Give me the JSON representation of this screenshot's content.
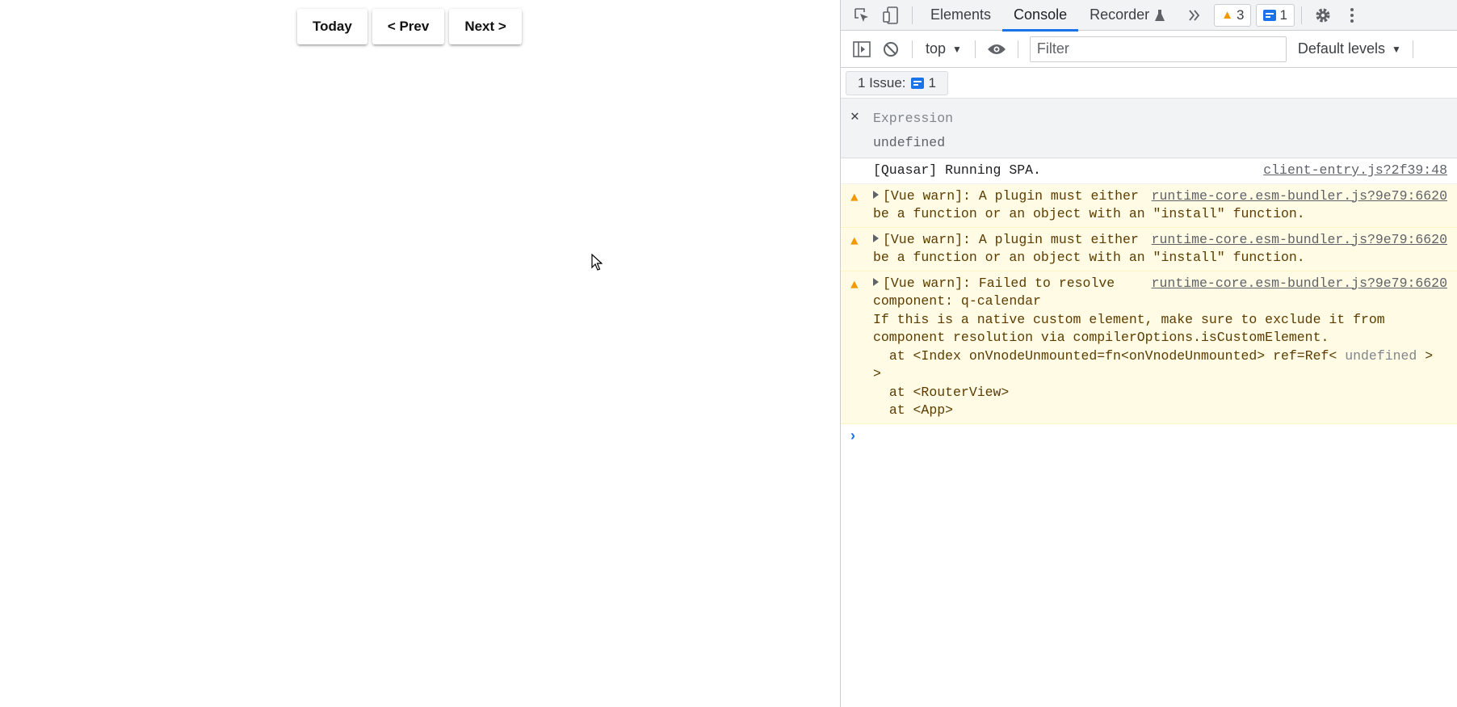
{
  "app": {
    "buttons": {
      "today": "Today",
      "prev": "< Prev",
      "next": "Next >"
    }
  },
  "devtools": {
    "tabs": [
      "Elements",
      "Console",
      "Recorder"
    ],
    "active_tab": "Console",
    "warn_count": "3",
    "msg_count": "1",
    "context": "top",
    "filter_placeholder": "Filter",
    "levels": "Default levels",
    "issues_label": "1 Issue:",
    "issues_count": "1",
    "expression": {
      "label": "Expression",
      "value": "undefined"
    },
    "logs": [
      {
        "text": "[Quasar] Running SPA.",
        "source": "client-entry.js?2f39:48"
      },
      {
        "text": "[Vue warn]: A plugin must either be a function or an object with an \"install\" function.",
        "source": "runtime-core.esm-bundler.js?9e79:6620"
      },
      {
        "text": "[Vue warn]: A plugin must either be a function or an object with an \"install\" function.",
        "source": "runtime-core.esm-bundler.js?9e79:6620"
      },
      {
        "text": "[Vue warn]: Failed to resolve component: q-calendar\nIf this is a native custom element, make sure to exclude it from component resolution via compilerOptions.isCustomElement.\n  at <Index onVnodeUnmounted=fn<onVnodeUnmounted> ref=Ref< ",
        "text_dim": "undefined",
        "text_tail": " >\n>\n  at <RouterView>\n  at <App>",
        "source": "runtime-core.esm-bundler.js?9e79:6620"
      }
    ],
    "prompt": "›"
  }
}
